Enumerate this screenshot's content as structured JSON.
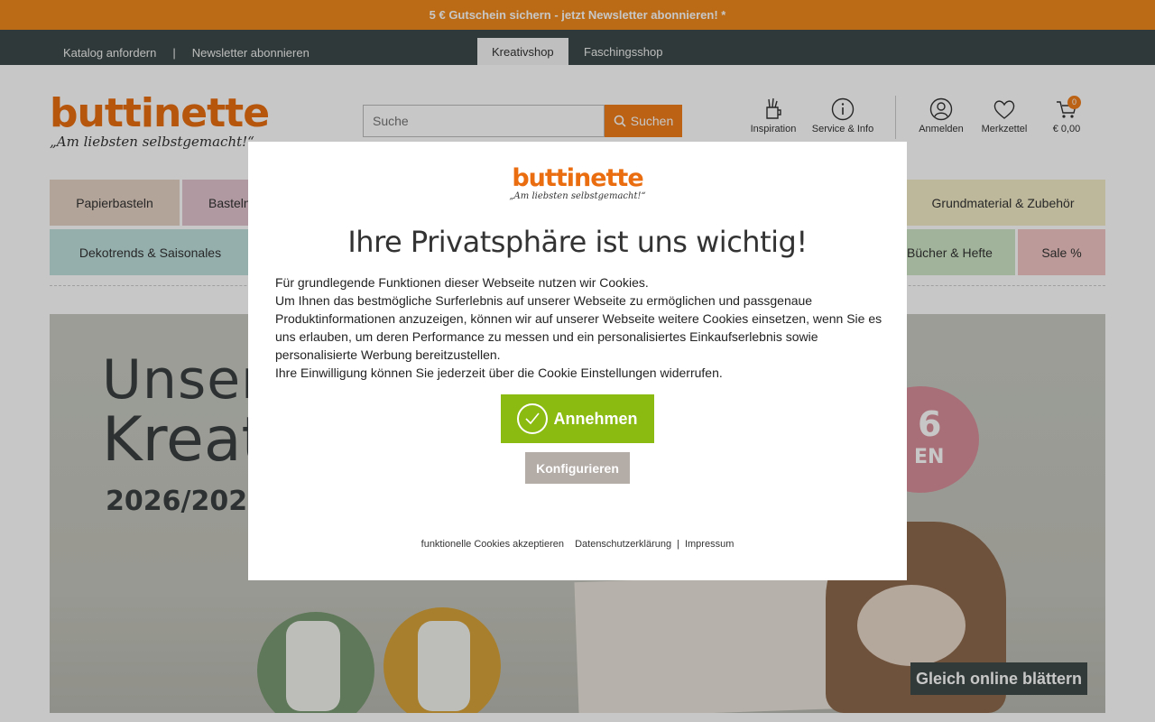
{
  "promo": {
    "text": "5 € Gutschein sichern - jetzt Newsletter abonnieren! *"
  },
  "topnav": {
    "links": [
      "Katalog anfordern",
      "|",
      "Newsletter abonnieren"
    ],
    "tabs": [
      "Kreativshop",
      "Faschingsshop"
    ],
    "active_tab": "Kreativshop"
  },
  "logo": {
    "name": "buttinette",
    "slogan": "„Am liebsten selbstgemacht!“"
  },
  "search": {
    "placeholder": "Suche",
    "button": "Suchen"
  },
  "header_icons": {
    "inspiration": "Inspiration",
    "service": "Service & Info",
    "login": "Anmelden",
    "wishlist": "Merkzettel",
    "cart_total": "€ 0,00",
    "cart_count": "0"
  },
  "categories": {
    "row1": [
      "Papierbasteln",
      "Basteln",
      "Grundmaterial & Zubehör"
    ],
    "row2": [
      "Dekotrends & Saisonales",
      "Bücher & Hefte",
      "Sale %"
    ]
  },
  "category_colors": {
    "papierbasteln": "#e6d2c4",
    "basteln": "#e2c4cf",
    "grundmaterial": "#f3ecc7",
    "dekotrends": "#bfe0de",
    "buecher": "#cfe6c6",
    "sale": "#f1c6c4"
  },
  "banner": {
    "headline1": "Unser n",
    "headline2": "Kreati",
    "headline3": "2026/2027",
    "badge_number": "6",
    "badge_text": "EN",
    "cta": "Gleich online blättern"
  },
  "modal": {
    "logo_name": "buttinette",
    "logo_slogan": "„Am liebsten selbstgemacht!“",
    "title": "Ihre Privatsphäre ist uns wichtig!",
    "text": [
      "Für grundlegende Funktionen dieser Webseite nutzen wir Cookies.",
      "Um Ihnen das bestmögliche Surferlebnis auf unserer Webseite zu ermöglichen und passgenaue Produktinformationen anzuzeigen, können wir auf unserer Webseite weitere Cookies einsetzen, wenn Sie es uns erlauben, um deren Performance zu messen und ein personalisiertes Einkaufserlebnis sowie personalisierte Werbung bereitzustellen.",
      "Ihre Einwilligung können Sie jederzeit über die Cookie Einstellungen widerrufen."
    ],
    "accept": "Annehmen",
    "configure": "Konfigurieren",
    "footer": {
      "functional": "funktionelle Cookies akzeptieren",
      "privacy": "Datenschutzerklärung",
      "sep": "|",
      "imprint": "Impressum"
    },
    "accent_green": "#8bba11",
    "accent_orange": "#ea6e10"
  }
}
